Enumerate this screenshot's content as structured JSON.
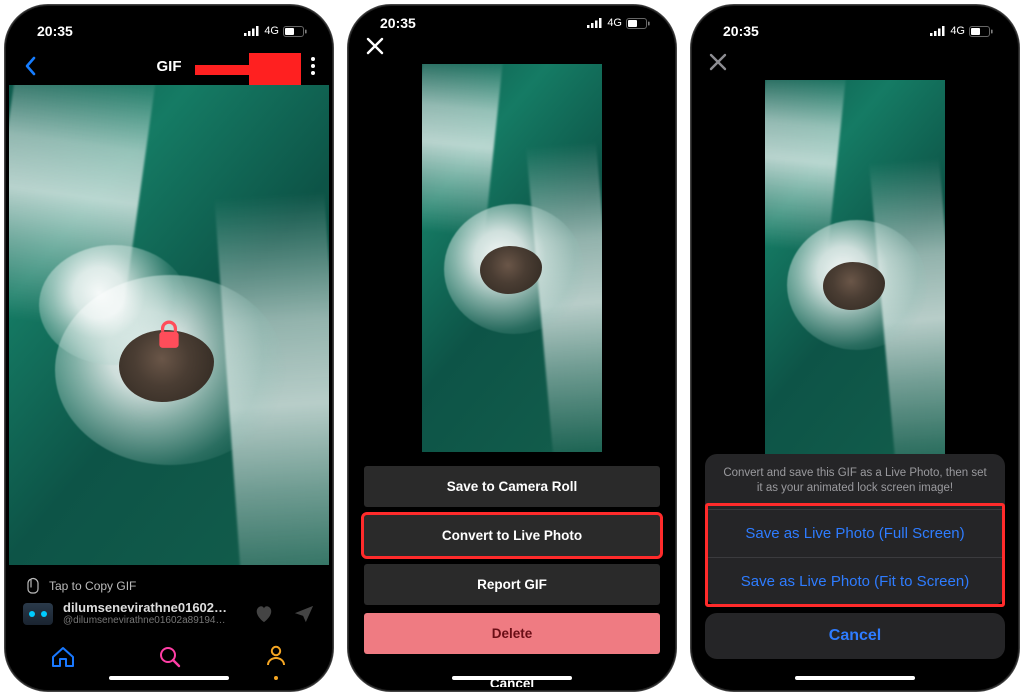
{
  "status": {
    "time": "20:35",
    "network": "4G"
  },
  "panel1": {
    "title": "GIF",
    "tap_label": "Tap to Copy GIF",
    "username": "dilumsenevirathne01602…",
    "userhandle": "@dilumsenevirathne01602a89194…"
  },
  "panel2": {
    "menu": {
      "save": "Save to Camera Roll",
      "convert": "Convert to Live Photo",
      "report": "Report GIF",
      "delete": "Delete",
      "cancel": "Cancel"
    }
  },
  "panel3": {
    "message": "Convert and save this GIF as a Live Photo, then set it as your animated lock screen image!",
    "opt_full": "Save as Live Photo (Full Screen)",
    "opt_fit": "Save as Live Photo (Fit to Screen)",
    "cancel": "Cancel"
  }
}
